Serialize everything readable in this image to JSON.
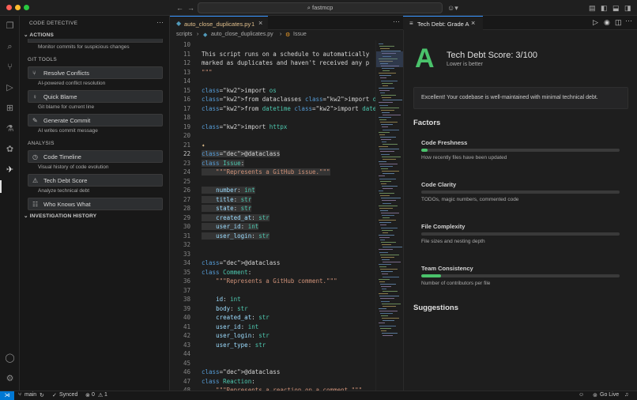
{
  "titlebar": {
    "search": "fastmcp"
  },
  "sidebar": {
    "title": "CODE DETECTIVE",
    "actions_header": "ACTIONS",
    "actions_desc": "Monitor commits for suspicious changes",
    "git_tools_label": "GIT TOOLS",
    "buttons": [
      {
        "label": "Resolve Conflicts",
        "desc": "AI-powered conflict resolution"
      },
      {
        "label": "Quick Blame",
        "desc": "Git blame for current line"
      },
      {
        "label": "Generate Commit",
        "desc": "AI writes commit message"
      }
    ],
    "analysis_label": "ANALYSIS",
    "analysis_buttons": [
      {
        "label": "Code Timeline",
        "desc": "Visual history of code evolution"
      },
      {
        "label": "Tech Debt Score",
        "desc": "Analyze technical debt"
      },
      {
        "label": "Who Knows What",
        "desc": ""
      }
    ],
    "history_header": "INVESTIGATION HISTORY"
  },
  "editor": {
    "tab_label": "auto_close_duplicates.py",
    "tab_badge": "1",
    "breadcrumb": [
      "scripts",
      "auto_close_duplicates.py",
      "Issue"
    ]
  },
  "code_lines": [
    {
      "n": "10",
      "t": ""
    },
    {
      "n": "11",
      "t": "This script runs on a schedule to automatically"
    },
    {
      "n": "12",
      "t": "marked as duplicates and haven't received any p"
    },
    {
      "n": "13",
      "t": "\"\"\""
    },
    {
      "n": "14",
      "t": ""
    },
    {
      "n": "15",
      "t": "import os"
    },
    {
      "n": "16",
      "t": "from dataclasses import dataclass"
    },
    {
      "n": "17",
      "t": "from datetime import datetime, timedelta, timez"
    },
    {
      "n": "18",
      "t": ""
    },
    {
      "n": "19",
      "t": "import httpx"
    },
    {
      "n": "20",
      "t": ""
    },
    {
      "n": "21",
      "t": "✦"
    },
    {
      "n": "22",
      "t": "@dataclass"
    },
    {
      "n": "23",
      "t": "class Issue:"
    },
    {
      "n": "24",
      "t": "    \"\"\"Represents a GitHub issue.\"\"\""
    },
    {
      "n": "25",
      "t": ""
    },
    {
      "n": "26",
      "t": "    number: int"
    },
    {
      "n": "27",
      "t": "    title: str"
    },
    {
      "n": "28",
      "t": "    state: str"
    },
    {
      "n": "29",
      "t": "    created_at: str"
    },
    {
      "n": "30",
      "t": "    user_id: int"
    },
    {
      "n": "31",
      "t": "    user_login: str"
    },
    {
      "n": "32",
      "t": ""
    },
    {
      "n": "33",
      "t": ""
    },
    {
      "n": "34",
      "t": "@dataclass"
    },
    {
      "n": "35",
      "t": "class Comment:"
    },
    {
      "n": "36",
      "t": "    \"\"\"Represents a GitHub comment.\"\"\""
    },
    {
      "n": "37",
      "t": ""
    },
    {
      "n": "38",
      "t": "    id: int"
    },
    {
      "n": "39",
      "t": "    body: str"
    },
    {
      "n": "40",
      "t": "    created_at: str"
    },
    {
      "n": "41",
      "t": "    user_id: int"
    },
    {
      "n": "42",
      "t": "    user_login: str"
    },
    {
      "n": "43",
      "t": "    user_type: str"
    },
    {
      "n": "44",
      "t": ""
    },
    {
      "n": "45",
      "t": ""
    },
    {
      "n": "46",
      "t": "@dataclass"
    },
    {
      "n": "47",
      "t": "class Reaction:"
    },
    {
      "n": "48",
      "t": "    \"\"\"Represents a reaction on a comment.\"\"\""
    }
  ],
  "panel": {
    "tab_label": "Tech Debt: Grade A",
    "grade": "A",
    "score_title": "Tech Debt Score: 3/100",
    "score_sub": "Lower is better",
    "message": "Excellent! Your codebase is well-maintained with minimal technical debt.",
    "factors_title": "Factors",
    "factors": [
      {
        "name": "Code Freshness",
        "desc": "How recently files have been updated",
        "value": 0.03
      },
      {
        "name": "Code Clarity",
        "desc": "TODOs, magic numbers, commented code",
        "value": 0.0
      },
      {
        "name": "File Complexity",
        "desc": "File sizes and nesting depth",
        "value": 0.0
      },
      {
        "name": "Team Consistency",
        "desc": "Number of contributors per file",
        "value": 0.1
      }
    ],
    "suggestions_title": "Suggestions"
  },
  "status": {
    "branch": "main",
    "sync": "Synced",
    "errors": "0",
    "warnings": "1",
    "go_live": "Go Live"
  },
  "colors": {
    "accent": "#3794ff",
    "grade_green": "#4ac26b",
    "remote": "#0078d4"
  }
}
